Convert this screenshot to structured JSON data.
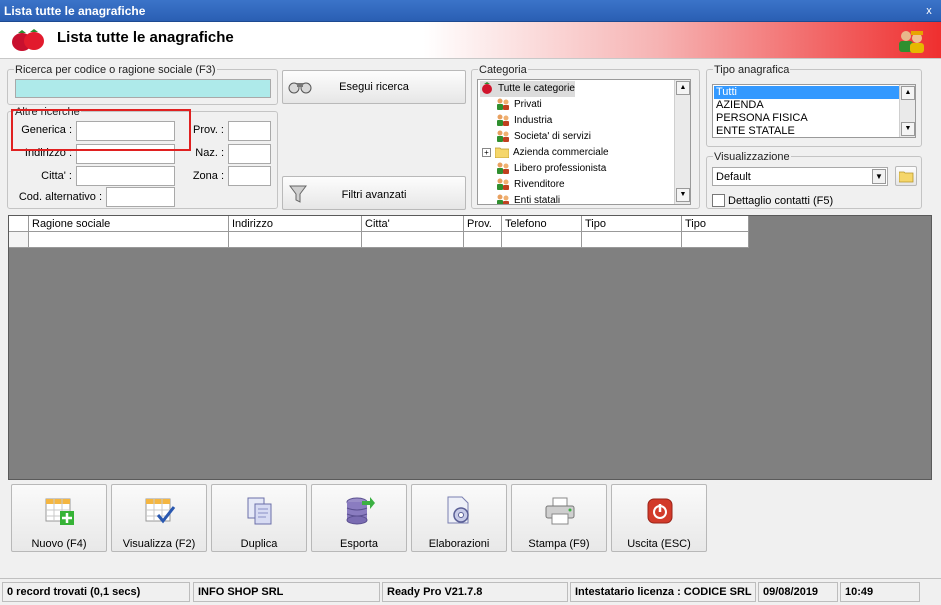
{
  "window": {
    "title": "Lista tutte le anagrafiche",
    "close": "x"
  },
  "header": {
    "title": "Lista tutte le anagrafiche"
  },
  "search": {
    "group_label": "Ricerca per codice o ragione sociale (F3)",
    "value": "",
    "search_button": "Esegui ricerca"
  },
  "other": {
    "group_label": "Altre ricerche",
    "generica": "Generica :",
    "prov": "Prov. :",
    "indirizzo": "Indirizzo :",
    "naz": "Naz. :",
    "citta": "Citta' :",
    "zona": "Zona :",
    "cod_alt": "Cod. alternativo :",
    "filters_button": "Filtri avanzati"
  },
  "categoria": {
    "label": "Categoria",
    "items": [
      "Tutte le categorie",
      "Privati",
      "Industria",
      "Societa' di servizi",
      "Azienda commerciale",
      "Libero professionista",
      "Rivenditore",
      "Enti statali"
    ]
  },
  "tipo": {
    "label": "Tipo anagrafica",
    "items": [
      "Tutti",
      "AZIENDA",
      "PERSONA FISICA",
      "ENTE STATALE"
    ]
  },
  "visual": {
    "label": "Visualizzazione",
    "selected": "Default",
    "contacts": "Dettaglio contatti (F5)"
  },
  "grid": {
    "columns": [
      "Ragione sociale",
      "Indirizzo",
      "Citta'",
      "Prov.",
      "Telefono",
      "Tipo",
      "Tipo"
    ]
  },
  "toolbar": {
    "nuovo": "Nuovo (F4)",
    "visualizza": "Visualizza (F2)",
    "duplica": "Duplica",
    "esporta": "Esporta",
    "elaborazioni": "Elaborazioni",
    "stampa": "Stampa (F9)",
    "uscita": "Uscita (ESC)"
  },
  "status": {
    "records": "0 record trovati (0,1 secs)",
    "company": "INFO SHOP SRL",
    "version": "Ready Pro V21.7.8",
    "license": "Intestatario licenza : CODICE SRL",
    "date": "09/08/2019",
    "time": "10:49"
  }
}
